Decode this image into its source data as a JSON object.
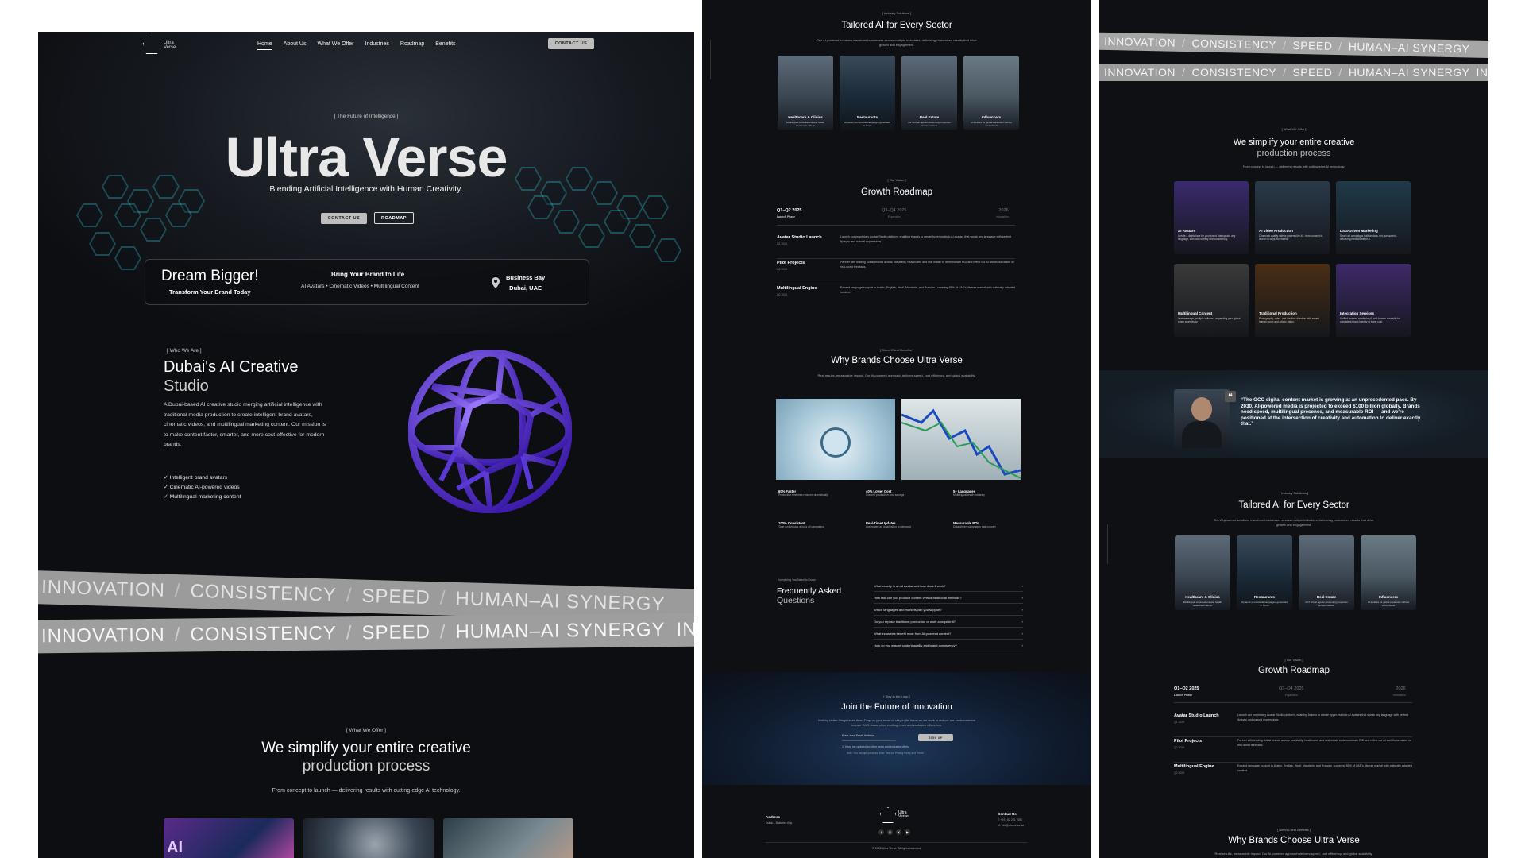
{
  "home": {
    "logo": {
      "text": "Ultra Verse"
    },
    "nav": [
      "Home",
      "About Us",
      "What We Offer",
      "Industries",
      "Roadmap",
      "Benefits"
    ],
    "nav_cta": "CONTACT US",
    "hero": {
      "tag": "[ The Future of Intelligence ]",
      "title": "Ultra Verse",
      "subtitle": "Blending Artificial Intelligence with Human Creativity.",
      "btn_contact": "CONTACT US",
      "btn_roadmap": "ROADMAP"
    },
    "infobar": {
      "dream": "Dream Bigger!",
      "transform": "Transform Your Brand Today",
      "bring": "Bring Your Brand to Life",
      "list": "AI Avatars • Cinematic Videos • Multilingual Content",
      "location_1": "Business Bay",
      "location_2": "Dubai, UAE"
    },
    "who": {
      "tag": "[ Who We Are ]",
      "title_1": "Dubai's AI Creative",
      "title_2": "Studio",
      "body": "A Dubai-based AI creative studio merging artificial intelligence with traditional media production to create intelligent brand avatars, cinematic videos, and multilingual marketing content. Our mission is to make content faster, smarter, and more cost-effective for modern brands.",
      "checks": [
        "Intelligent brand avatars",
        "Cinematic AI-powered videos",
        "Multilingual marketing content"
      ]
    },
    "bands": {
      "row1": [
        "INNOVATION",
        "CONSISTENCY",
        "SPEED",
        "HUMAN–AI SYNERGY"
      ],
      "row2": [
        "INNOVATION",
        "CONSISTENCY",
        "SPEED",
        "HUMAN–AI SYNERGY",
        "INNOVATION"
      ]
    },
    "offer": {
      "tag": "[ What We Offer ]",
      "title_1": "We simplify your entire creative",
      "title_2": "production process",
      "sub": "From concept to launch — delivering results with cutting-edge AI technology."
    }
  },
  "industries": {
    "tag": "[ Industry Solutions ]",
    "title": "Tailored AI for Every Sector",
    "sub": "Our AI-powered solutions transform businesses across multiple industries, delivering customized results that drive growth and engagement.",
    "cards": [
      {
        "name": "Healthcare & Clinics",
        "desc": "Multilingual consultations and health awareness videos"
      },
      {
        "name": "Restaurants",
        "desc": "Dynamic promotional campaigns generated in hours"
      },
      {
        "name": "Real Estate",
        "desc": "24/7 virtual agents presenting properties across markets"
      },
      {
        "name": "Influencers",
        "desc": "AI doubles for global expansion without extra shoots"
      }
    ]
  },
  "roadmap": {
    "tag": "[ Our Vision ]",
    "title": "Growth Roadmap",
    "phases": [
      {
        "label": "Q1–Q2 2025",
        "sub": "Launch Phase"
      },
      {
        "label": "Q3–Q4 2025",
        "sub": "Expansion"
      },
      {
        "label": "2026",
        "sub": "Innovation"
      }
    ],
    "rows": [
      {
        "title": "Avatar Studio Launch",
        "when": "Q1 2025",
        "desc": "Launch our proprietary Avatar Studio platform, enabling brands to create hyper-realistic AI avatars that speak any language with perfect lip-sync and natural expressions."
      },
      {
        "title": "Pilot Projects",
        "when": "Q2 2025",
        "desc": "Partner with leading Dubai brands across hospitality, healthcare, and real estate to demonstrate ROI and refine our AI workflows based on real-world feedback."
      },
      {
        "title": "Multilingual Engine",
        "when": "Q2 2025",
        "desc": "Expand language support to Arabic, English, Hindi, Mandarin, and Russian - covering 85% of UAE's diverse market with culturally adapted content."
      }
    ]
  },
  "benefits": {
    "tag": "[ Direct Client Benefits ]",
    "title": "Why Brands Choose Ultra Verse",
    "sub": "Real results, measurable impact. Our AI-powered approach delivers speed, cost efficiency, and global scalability.",
    "stats": [
      {
        "title": "60% Faster",
        "desc": "Production timelines reduced dramatically"
      },
      {
        "title": "40% Lower Cost",
        "desc": "Content production cost savings"
      },
      {
        "title": "5+ Languages",
        "desc": "Multilingual reach instantly"
      },
      {
        "title": "100% Consistent",
        "desc": "Tone and visuals across all campaigns"
      },
      {
        "title": "Real-Time Updates",
        "desc": "Automated ad localization on demand"
      },
      {
        "title": "Measurable ROI",
        "desc": "Data-driven campaigns that convert"
      }
    ]
  },
  "faq": {
    "tag": "Everything You Need to Know",
    "title_1": "Frequently Asked",
    "title_2": "Questions",
    "items": [
      "What exactly is an AI Avatar and how does it work?",
      "How fast can you produce content versus traditional methods?",
      "Which languages and markets can you support?",
      "Do you replace traditional production or work alongside it?",
      "What industries benefit most from AI-powered content?",
      "How do you ensure content quality and brand consistency?"
    ]
  },
  "newsletter": {
    "tag": "[ Stay in the Loop ]",
    "title": "Join the Future of Innovation",
    "sub": "Making better things takes time. Drop us your email to stay in the know as we work to reduce our environmental impact. We'll share other exciting news and exclusive offers, too.",
    "placeholder": "Enter Your Email Address",
    "button": "SIGN UP",
    "check": "Keep me updated on other news and exclusive offers",
    "note": "Note: You can opt-out at any time. See our Privacy Policy and Terms."
  },
  "footer": {
    "address_label": "Address",
    "address": "Dubai – Business Bay",
    "contact_label": "Contact Us",
    "phone": "T: +971 52 281 7050",
    "email": "M: info@ultraverse.ae",
    "copyright": "© 2026 Ultra Verse. All rights reserved."
  },
  "services": {
    "tag": "[ What We Offer ]",
    "title_1": "We simplify your entire creative",
    "title_2": "production process",
    "sub": "From concept to launch — delivering results with cutting-edge AI technology.",
    "cards": [
      {
        "name": "AI Avatars",
        "desc": "Create a digital face for your brand that speaks any language, with total identity and consistency.",
        "color": "#3a2a6e"
      },
      {
        "name": "AI Video Production",
        "desc": "Cinematic quality videos powered by AI - from concept to launch in days, not weeks.",
        "color": "#2a3a4a"
      },
      {
        "name": "Data-Driven Marketing",
        "desc": "Smart ad campaigns built on data, not guesswork - delivering measurable ROI.",
        "color": "#1f3a4a"
      },
      {
        "name": "Multilingual Content",
        "desc": "One message, multiple cultures - expanding your global reach seamlessly.",
        "color": "#3a3a3a"
      },
      {
        "name": "Traditional Production",
        "desc": "Photography, video, and creative direction with expert human touch and artistic vision.",
        "color": "#4a2e14"
      },
      {
        "name": "Integration Services",
        "desc": "Unified process combining AI and human creativity for consistent brand identity at lower cost.",
        "color": "#3e2a6a"
      }
    ]
  },
  "quote": {
    "text": "“The GCC digital content market is growing at an unprecedented pace. By 2030, AI-powered media is projected to exceed $100 billion globally. Brands need speed, multilingual presence, and measurable ROI — and we're positioned at the intersection of creativity and automation to deliver exactly that.”"
  },
  "side_label": "Industries"
}
